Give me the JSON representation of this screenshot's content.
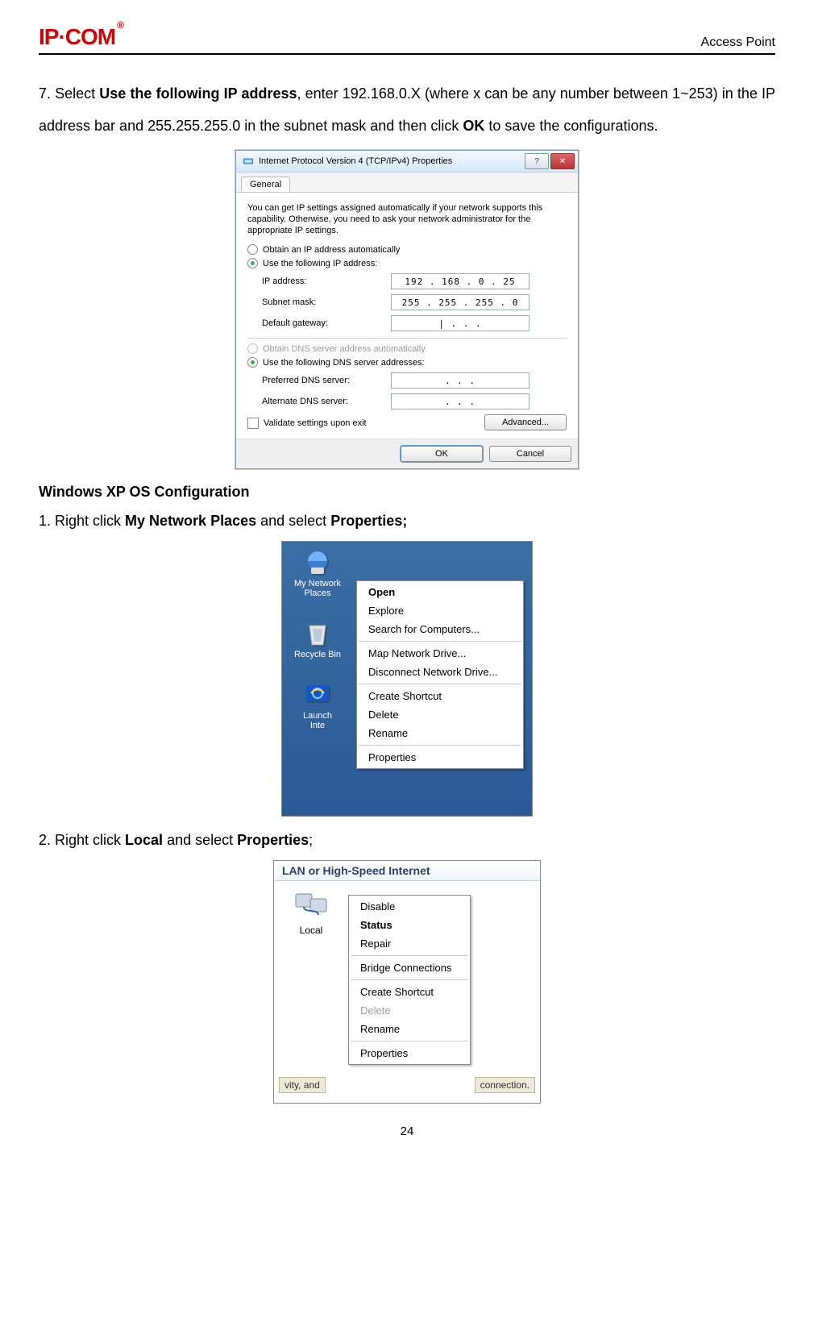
{
  "header": {
    "logo_text": "IP·COM",
    "right_text": "Access Point"
  },
  "para1_parts": {
    "p1": "7. Select ",
    "b1": "Use the following IP address",
    "p2": ", enter 192.168.0.X (where x can be any number between 1~253) in the IP address bar and 255.255.255.0 in the subnet mask and then click ",
    "b2": "OK",
    "p3": " to save the configurations."
  },
  "dialog1": {
    "title": "Internet Protocol Version 4 (TCP/IPv4) Properties",
    "tab": "General",
    "hint": "You can get IP settings assigned automatically if your network supports this capability. Otherwise, you need to ask your network administrator for the appropriate IP settings.",
    "radio_obtain_ip": "Obtain an IP address automatically",
    "radio_use_ip": "Use the following IP address:",
    "lbl_ip": "IP address:",
    "val_ip": "192 . 168 .  0  . 25",
    "lbl_mask": "Subnet mask:",
    "val_mask": "255 . 255 . 255 .  0",
    "lbl_gw": "Default gateway:",
    "val_gw": "|    .       .       .",
    "radio_obtain_dns": "Obtain DNS server address automatically",
    "radio_use_dns": "Use the following DNS server addresses:",
    "lbl_pref_dns": "Preferred DNS server:",
    "val_pref_dns": ".       .       .",
    "lbl_alt_dns": "Alternate DNS server:",
    "val_alt_dns": ".       .       .",
    "chk_validate": "Validate settings upon exit",
    "btn_adv": "Advanced...",
    "btn_ok": "OK",
    "btn_cancel": "Cancel",
    "help_glyph": "?"
  },
  "section_xp": "Windows XP OS Configuration",
  "step1": {
    "pre": "1. Right click ",
    "b1": "My Network Places",
    "mid": " and select ",
    "b2": "Properties;",
    "post": ""
  },
  "fig2": {
    "icon1": "My Network Places",
    "icon2": "Recycle Bin",
    "icon3_a": "Launch",
    "icon3_b": "Inte",
    "ctx": [
      "Open",
      "Explore",
      "Search for Computers...",
      "Map Network Drive...",
      "Disconnect Network Drive...",
      "Create Shortcut",
      "Delete",
      "Rename",
      "Properties"
    ]
  },
  "step2": {
    "pre": "2.    Right click ",
    "b1": "Local",
    "mid": " and select ",
    "b2": "Properties",
    "post": ";"
  },
  "fig3": {
    "heading": "LAN or High-Speed Internet",
    "icon_label": "Local",
    "ctx": [
      "Disable",
      "Status",
      "Repair",
      "Bridge Connections",
      "Create Shortcut",
      "Delete",
      "Rename",
      "Properties"
    ],
    "disabled_idx": 5,
    "bold_idx": 1,
    "bottom_left": "vity, and",
    "bottom_right": "connection."
  },
  "page_number": "24"
}
